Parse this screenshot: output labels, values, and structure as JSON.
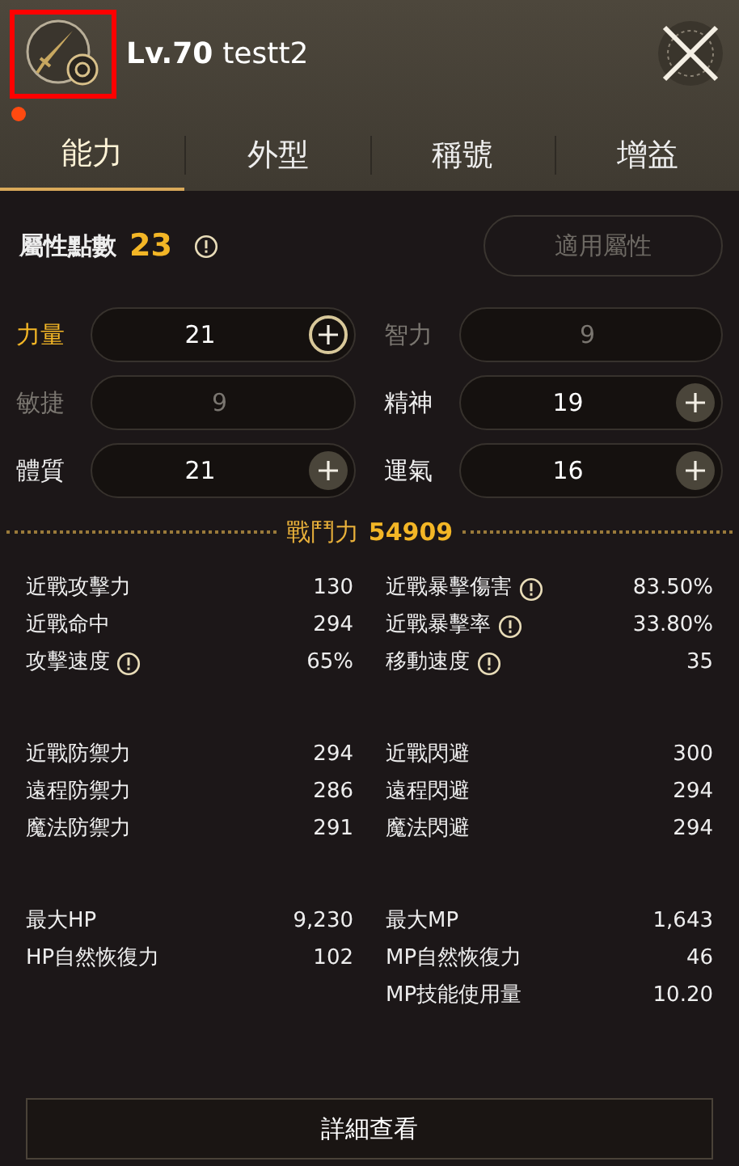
{
  "header": {
    "level": "Lv.70",
    "name": "testt2",
    "notification_dot": true
  },
  "tabs": [
    {
      "label": "能力",
      "selected": true
    },
    {
      "label": "外型",
      "selected": false
    },
    {
      "label": "稱號",
      "selected": false
    },
    {
      "label": "增益",
      "selected": false
    }
  ],
  "points": {
    "label": "屬性點數",
    "value": "23",
    "apply_button": {
      "label": "適用屬性",
      "disabled": true
    }
  },
  "attributes": [
    {
      "label": "力量",
      "value": "21",
      "highlighted": true,
      "disabled": false
    },
    {
      "label": "智力",
      "value": "9",
      "highlighted": false,
      "disabled": true
    },
    {
      "label": "敏捷",
      "value": "9",
      "highlighted": false,
      "disabled": true
    },
    {
      "label": "精神",
      "value": "19",
      "highlighted": false,
      "disabled": false
    },
    {
      "label": "體質",
      "value": "21",
      "highlighted": false,
      "disabled": false
    },
    {
      "label": "運氣",
      "value": "16",
      "highlighted": false,
      "disabled": false
    }
  ],
  "combat_power": {
    "label": "戰鬥力",
    "value": "54909"
  },
  "stat_groups": [
    {
      "left": [
        {
          "label": "近戰攻擊力",
          "value": "130",
          "info": false
        },
        {
          "label": "近戰命中",
          "value": "294",
          "info": false
        },
        {
          "label": "攻擊速度",
          "value": "65%",
          "info": true
        }
      ],
      "right": [
        {
          "label": "近戰暴擊傷害",
          "value": "83.50%",
          "info": true
        },
        {
          "label": "近戰暴擊率",
          "value": "33.80%",
          "info": true
        },
        {
          "label": "移動速度",
          "value": "35",
          "info": true
        }
      ]
    },
    {
      "left": [
        {
          "label": "近戰防禦力",
          "value": "294",
          "info": false
        },
        {
          "label": "遠程防禦力",
          "value": "286",
          "info": false
        },
        {
          "label": "魔法防禦力",
          "value": "291",
          "info": false
        }
      ],
      "right": [
        {
          "label": "近戰閃避",
          "value": "300",
          "info": false
        },
        {
          "label": "遠程閃避",
          "value": "294",
          "info": false
        },
        {
          "label": "魔法閃避",
          "value": "294",
          "info": false
        }
      ]
    },
    {
      "left": [
        {
          "label": "最大HP",
          "value": "9,230",
          "info": false
        },
        {
          "label": "HP自然恢復力",
          "value": "102",
          "info": false
        }
      ],
      "right": [
        {
          "label": "最大MP",
          "value": "1,643",
          "info": false
        },
        {
          "label": "MP自然恢復力",
          "value": "46",
          "info": false
        },
        {
          "label": "MP技能使用量",
          "value": "10.20",
          "info": false
        }
      ]
    }
  ],
  "detail_button": "詳細查看"
}
